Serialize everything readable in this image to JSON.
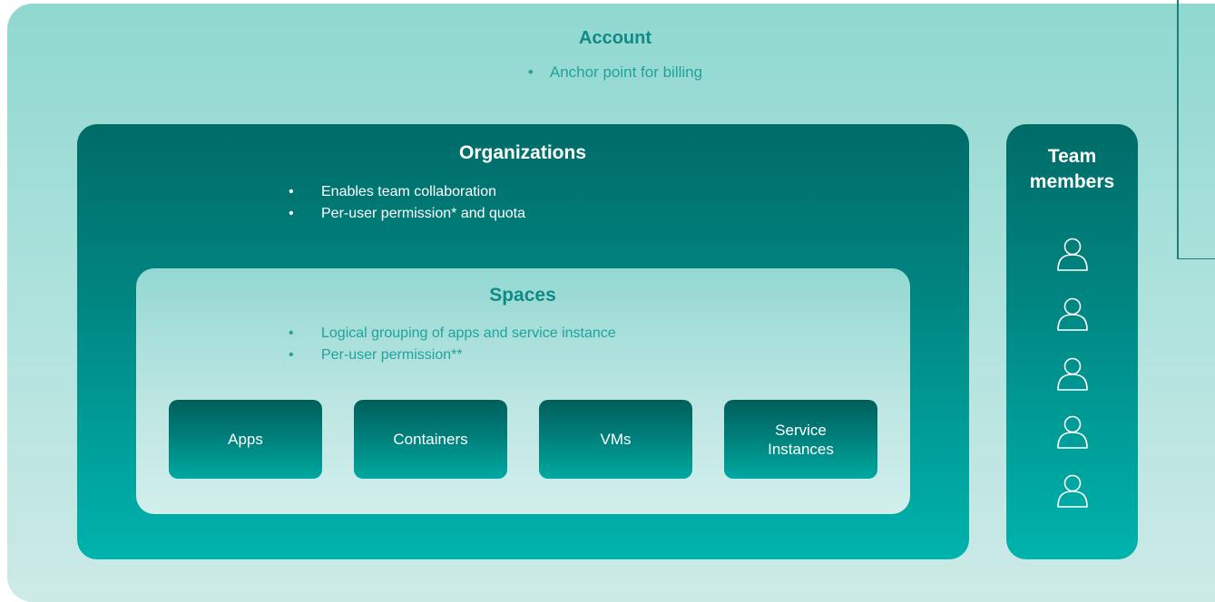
{
  "account": {
    "title": "Account",
    "bullets": [
      "Anchor point for billing"
    ]
  },
  "organizations": {
    "title": "Organizations",
    "bullets": [
      "Enables team collaboration",
      "Per-user permission* and quota"
    ]
  },
  "spaces": {
    "title": "Spaces",
    "bullets": [
      "Logical grouping of apps and service instance",
      "Per-user permission**"
    ]
  },
  "resources": {
    "apps": "Apps",
    "containers": "Containers",
    "vms": "VMs",
    "service_instances": "Service Instances"
  },
  "team": {
    "title": "Team members",
    "member_icon": "person-outline-icon",
    "member_count": 5
  },
  "bullet_glyph": "•",
  "colors": {
    "dark_teal": "#006b67",
    "teal": "#00b3ad",
    "light_teal": "#94d8d2",
    "title_teal": "#0f8a86",
    "text_teal": "#1fa39c"
  }
}
